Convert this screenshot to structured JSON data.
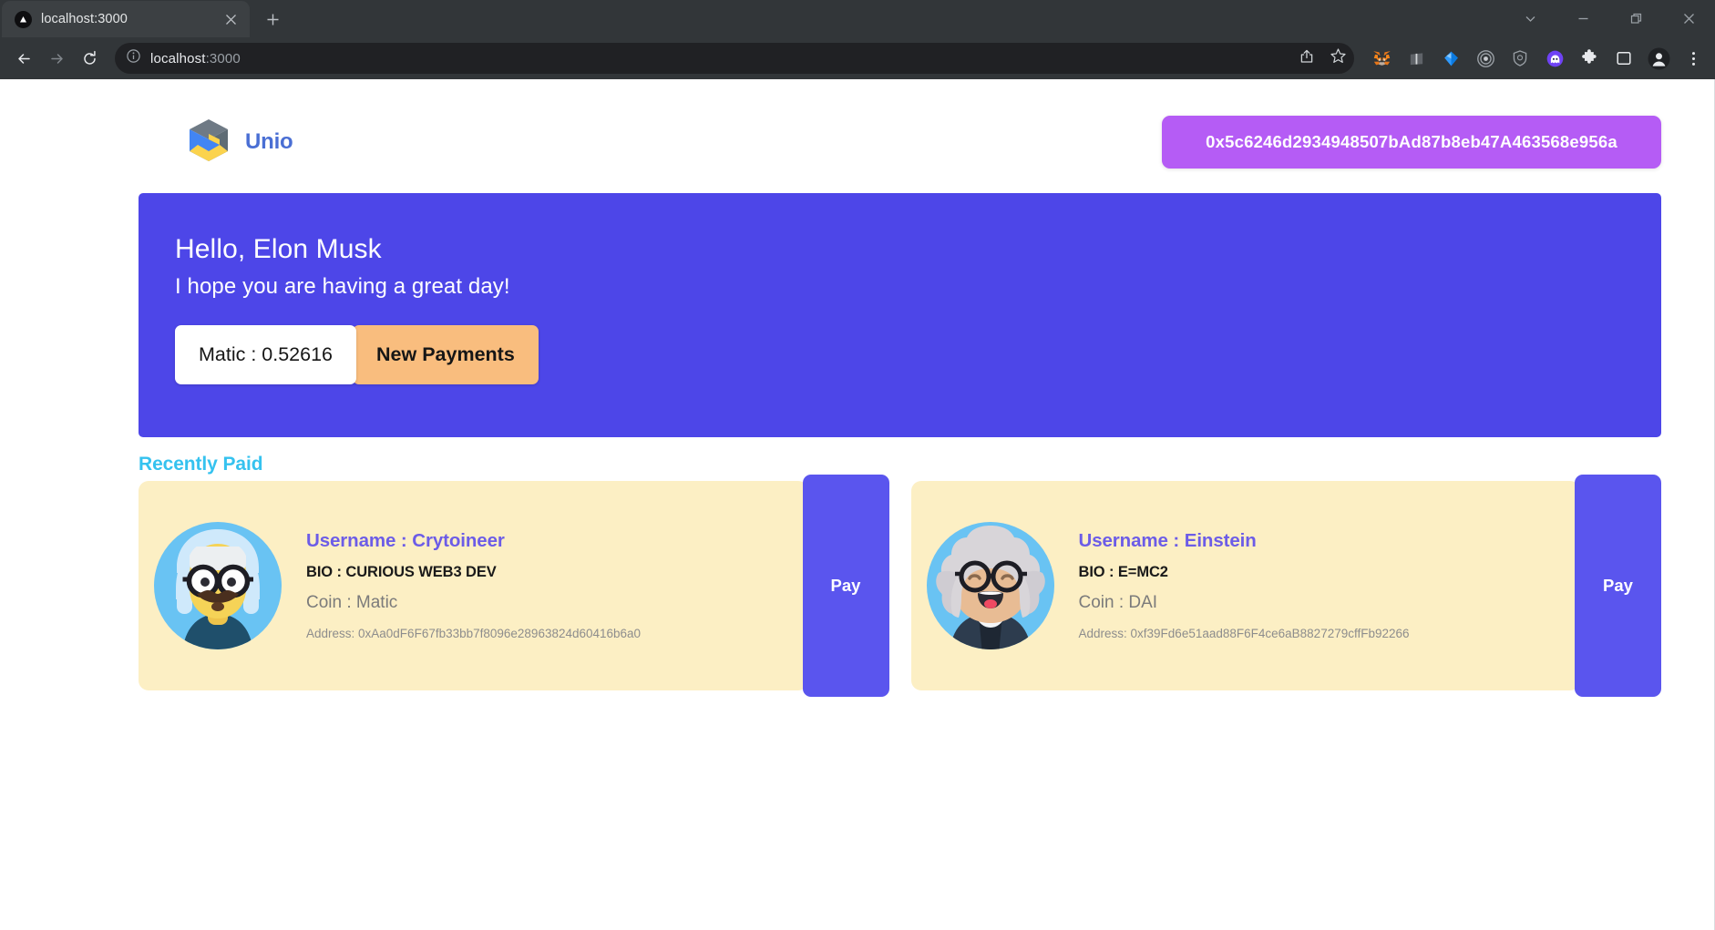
{
  "browser": {
    "tab": {
      "title": "localhost:3000",
      "favicon": "triangle-favicon",
      "close": "×"
    },
    "new_tab_label": "+",
    "window_controls": [
      {
        "name": "tab-search-button",
        "glyph": "⌄"
      },
      {
        "name": "minimize-button",
        "glyph": "—"
      },
      {
        "name": "maximize-button",
        "glyph": "❐"
      },
      {
        "name": "close-window-button",
        "glyph": "✕"
      }
    ],
    "nav": {
      "back": "back-arrow-icon",
      "forward": "forward-arrow-icon",
      "reload": "reload-icon"
    },
    "omnibox": {
      "site_info_icon": "info-circle-icon",
      "url_host": "localhost",
      "url_port": ":3000",
      "share_icon": "share-icon",
      "bookmark_icon": "star-icon"
    },
    "extensions": [
      {
        "name": "metamask-extension-icon",
        "color": "#e2761b"
      },
      {
        "name": "notebook-extension-icon",
        "color": "#5f6368"
      },
      {
        "name": "blue-diamond-extension-icon",
        "color": "#2f9bff"
      },
      {
        "name": "target-extension-icon",
        "color": "#9aa0a6"
      },
      {
        "name": "shield-extension-icon",
        "color": "#9aa0a6"
      },
      {
        "name": "ghost-extension-icon",
        "color": "#6f42f5"
      },
      {
        "name": "puzzle-extensions-button",
        "color": "#e8eaed"
      },
      {
        "name": "side-panel-button",
        "color": "#e8eaed"
      },
      {
        "name": "profile-avatar-button",
        "color": "#e8eaed"
      },
      {
        "name": "chrome-menu-button",
        "color": "#e8eaed"
      }
    ]
  },
  "page": {
    "brand": {
      "name": "Unio",
      "logo": "unio-cube-logo"
    },
    "wallet_address": "0x5c6246d2934948507bAd87b8eb47A463568e956a",
    "hero": {
      "greeting": "Hello, Elon Musk",
      "subtitle": "I hope you are having a great day!",
      "balance_label": "Matic : 0.52616",
      "new_payments_label": "New Payments"
    },
    "recently_paid": {
      "title": "Recently Paid",
      "pay_label": "Pay",
      "cards": [
        {
          "avatar": "man-with-mustache-glasses-avatar",
          "username": "Username : Crytoineer",
          "bio": "BIO : CURIOUS WEB3 DEV",
          "coin": "Coin : Matic",
          "address": "Address: 0xAa0dF6F67fb33bb7f8096e28963824d60416b6a0",
          "pay_label": "Pay"
        },
        {
          "avatar": "woman-white-hair-glasses-avatar",
          "username": "Username : Einstein",
          "bio": "BIO : E=MC2",
          "coin": "Coin : DAI",
          "address": "Address: 0xf39Fd6e51aad88F6F4ce6aB8827279cffFb92266",
          "pay_label": "Pay"
        }
      ]
    }
  },
  "colors": {
    "hero_bg": "#4d46e8",
    "wallet_pill": "#b55cf5",
    "card_bg": "#fcefc4",
    "pay_button": "#5a55ee",
    "section_title": "#35c2ef",
    "new_payments": "#f9bd7e",
    "username": "#6c5ce7"
  }
}
